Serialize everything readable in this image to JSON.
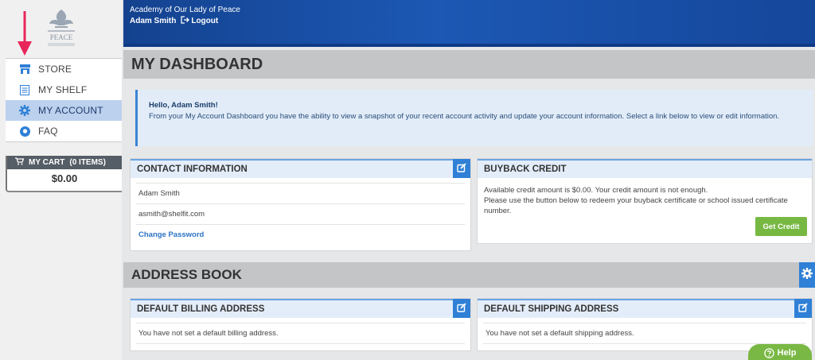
{
  "header": {
    "school_name": "Academy of Our Lady of Peace",
    "user_name": "Adam Smith",
    "logout_label": "Logout"
  },
  "sidebar": {
    "logo_text": "PEACE",
    "items": [
      {
        "label": "STORE",
        "icon": "store-icon"
      },
      {
        "label": "MY SHELF",
        "icon": "list-icon"
      },
      {
        "label": "MY ACCOUNT",
        "icon": "gear-icon",
        "active": true
      },
      {
        "label": "FAQ",
        "icon": "help-circle-icon"
      }
    ],
    "cart": {
      "label": "MY CART",
      "count": "(0 ITEMS)",
      "total": "$0.00"
    }
  },
  "dashboard": {
    "title": "MY DASHBOARD",
    "greeting": {
      "hello": "Hello, Adam Smith!",
      "message": "From your My Account Dashboard you have the ability to view a snapshot of your recent account activity and update your account information. Select a link below to view or edit information."
    },
    "contact": {
      "title": "CONTACT INFORMATION",
      "name": "Adam Smith",
      "email": "asmith@shelfit.com",
      "change_password": "Change Password"
    },
    "buyback": {
      "title": "BUYBACK CREDIT",
      "line1": "Available credit amount is $0.00. Your credit amount is not enough.",
      "line2": "Please use the button below to redeem your buyback certificate or school issued certificate number.",
      "button": "Get Credit"
    }
  },
  "address_book": {
    "title": "ADDRESS BOOK",
    "billing": {
      "title": "DEFAULT BILLING ADDRESS",
      "message": "You have not set a default billing address."
    },
    "shipping": {
      "title": "DEFAULT SHIPPING ADDRESS",
      "message": "You have not set a default shipping address."
    }
  },
  "help": {
    "label": "Help"
  },
  "colors": {
    "header_blue": "#1c58b4",
    "accent_blue": "#2f80d6",
    "active_nav": "#bcd1ee",
    "credit_green": "#77b843",
    "arrow_pink": "#e8265a"
  }
}
